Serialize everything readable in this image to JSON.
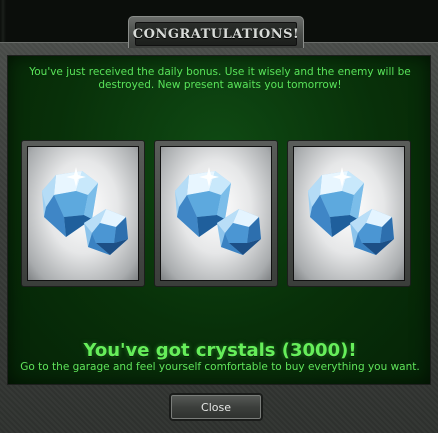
{
  "dialog": {
    "title": "CONGRATULATIONS!",
    "intro": "You've just received the daily bonus. Use it wisely and the enemy will be destroyed. New present awaits you tomorrow!",
    "result_title": "You've got crystals (3000)!",
    "result_subtitle": "Go to the garage and feel yourself comfortable to buy everything you want.",
    "close_label": "Close"
  },
  "rewards": [
    {
      "icon": "crystal-icon"
    },
    {
      "icon": "crystal-icon"
    },
    {
      "icon": "crystal-icon"
    }
  ],
  "colors": {
    "panel_green": "#083009",
    "text_green": "#59e35a",
    "frame_gray": "#3a3d3a"
  }
}
